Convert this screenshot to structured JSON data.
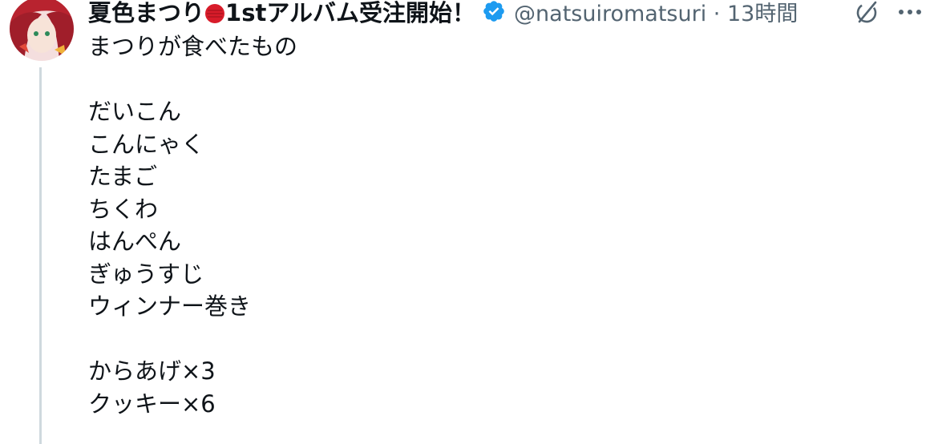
{
  "post": {
    "display_name": "夏色まつり",
    "display_name_suffix": "1stアルバム受注開始！",
    "handle": "@natsuiromatsuri",
    "separator": "·",
    "time": "13時間",
    "verified": true,
    "colors": {
      "badge_red": "#d81c2a",
      "verified_blue": "#1d9bf0",
      "handle_gray": "#536471",
      "thread_line": "#cfd9de"
    },
    "lines": [
      "まつりが食べたもの",
      "",
      "だいこん",
      "こんにゃく",
      "たまご",
      "ちくわ",
      "はんぺん",
      "ぎゅうすじ",
      "ウィンナー巻き",
      "",
      "からあげ×3",
      "クッキー×6"
    ]
  },
  "icons": {
    "verified": "verified-badge-icon",
    "grok": "grok-icon",
    "more": "more-icon",
    "badge": "red-circle-icon"
  }
}
